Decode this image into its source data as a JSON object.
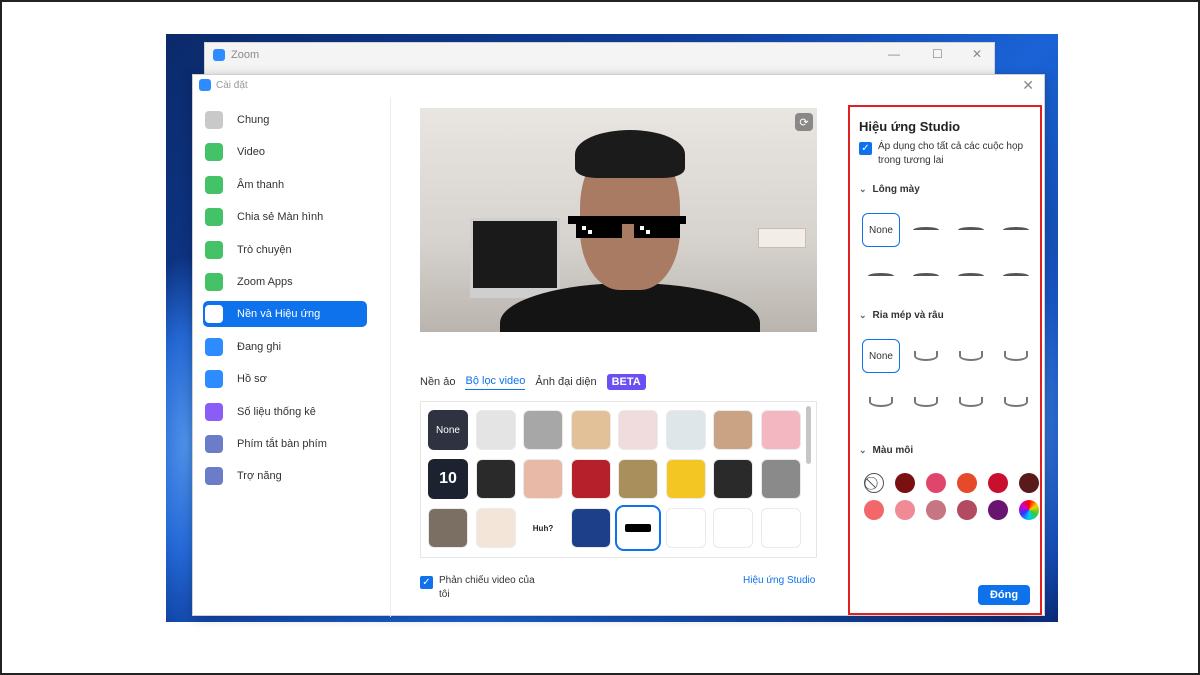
{
  "zoom_window": {
    "title": "Zoom",
    "minimize": "—",
    "maximize": "☐",
    "close": "✕"
  },
  "settings": {
    "title": "Cài đặt",
    "close": "✕",
    "sidebar": [
      {
        "label": "Chung",
        "icon": "gear-icon",
        "color": "#c9c9c9"
      },
      {
        "label": "Video",
        "icon": "video-camera-icon",
        "color": "#43c267"
      },
      {
        "label": "Âm thanh",
        "icon": "headphones-icon",
        "color": "#43c267"
      },
      {
        "label": "Chia sẻ Màn hình",
        "icon": "screen-share-icon",
        "color": "#43c267"
      },
      {
        "label": "Trò chuyện",
        "icon": "chat-icon",
        "color": "#43c267"
      },
      {
        "label": "Zoom Apps",
        "icon": "apps-icon",
        "color": "#43c267"
      },
      {
        "label": "Nền và Hiệu ứng",
        "icon": "background-icon",
        "color": "#0e72ed",
        "active": true
      },
      {
        "label": "Đang ghi",
        "icon": "record-icon",
        "color": "#2d8cff"
      },
      {
        "label": "Hồ sơ",
        "icon": "profile-icon",
        "color": "#2d8cff"
      },
      {
        "label": "Số liệu thống kê",
        "icon": "statistics-icon",
        "color": "#8b5cf6"
      },
      {
        "label": "Phím tắt bàn phím",
        "icon": "keyboard-icon",
        "color": "#6b7cc9"
      },
      {
        "label": "Trợ năng",
        "icon": "accessibility-icon",
        "color": "#6b7cc9"
      }
    ],
    "tabs": {
      "virtual_bg": "Nền ảo",
      "video_filter": "Bộ lọc video",
      "avatar": "Ảnh đại diện",
      "beta": "BETA"
    },
    "filters": {
      "none_label": "None",
      "tiles": [
        {
          "name": "filter-none",
          "color": "#2f3341"
        },
        {
          "name": "filter-white-room",
          "color": "#e4e4e4"
        },
        {
          "name": "filter-gray-room",
          "color": "#a7a7a7"
        },
        {
          "name": "filter-warm-room",
          "color": "#e2c199"
        },
        {
          "name": "filter-pink-room",
          "color": "#f0dcdc"
        },
        {
          "name": "filter-cool-room",
          "color": "#dfe6ea"
        },
        {
          "name": "filter-sepia-room",
          "color": "#c9a383"
        },
        {
          "name": "filter-rose-room",
          "color": "#f2b7c1"
        },
        {
          "name": "filter-10-zoom-frame",
          "color": "#1c2230",
          "text": "10"
        },
        {
          "name": "filter-tv-frame",
          "color": "#2a2a2a"
        },
        {
          "name": "filter-dog-frame",
          "color": "#e7b9a6"
        },
        {
          "name": "filter-theater-frame",
          "color": "#b5202a"
        },
        {
          "name": "filter-retro-tv-frame",
          "color": "#a88f5c"
        },
        {
          "name": "filter-sunflower-frame",
          "color": "#f3c623"
        },
        {
          "name": "filter-film-frame",
          "color": "#2a2a2a"
        },
        {
          "name": "filter-focus-frame",
          "color": "#8a8a8a"
        },
        {
          "name": "filter-old-tv",
          "color": "#7a6f62"
        },
        {
          "name": "filter-ribbon-badge",
          "color": "#f3e6d8"
        },
        {
          "name": "filter-speech-bubble",
          "color": "#ffffff",
          "text": "Huh?"
        },
        {
          "name": "filter-fairy-lights",
          "color": "#1d3f8a"
        },
        {
          "name": "filter-sunglasses",
          "color": "#ffffff",
          "selected": true
        },
        {
          "name": "filter-sprout",
          "color": "#ffffff"
        },
        {
          "name": "filter-rainbow",
          "color": "#ffffff"
        },
        {
          "name": "filter-party-hat",
          "color": "#ffffff"
        }
      ]
    },
    "mirror": {
      "checked_mark": "✓",
      "label": "Phản chiếu video của tôi"
    },
    "studio_link": "Hiệu ứng Studio",
    "studio_panel": {
      "title": "Hiệu ứng Studio",
      "apply_checked_mark": "✓",
      "apply_label": "Áp dụng cho tất cả các cuộc họp trong tương lai",
      "eyebrows": {
        "title": "Lông mày",
        "none_label": "None"
      },
      "mustache": {
        "title": "Ria mép và râu",
        "none_label": "None"
      },
      "lip_color": {
        "title": "Màu môi",
        "none_symbol": "⃠",
        "swatches": [
          "#7a1010",
          "#e0456b",
          "#e54a2a",
          "#c8102e",
          "#5a1a1a",
          "#f2676a",
          "#f08a95",
          "#c67582",
          "#b24a62",
          "#6a1472"
        ]
      },
      "close_button": "Đóng"
    }
  }
}
